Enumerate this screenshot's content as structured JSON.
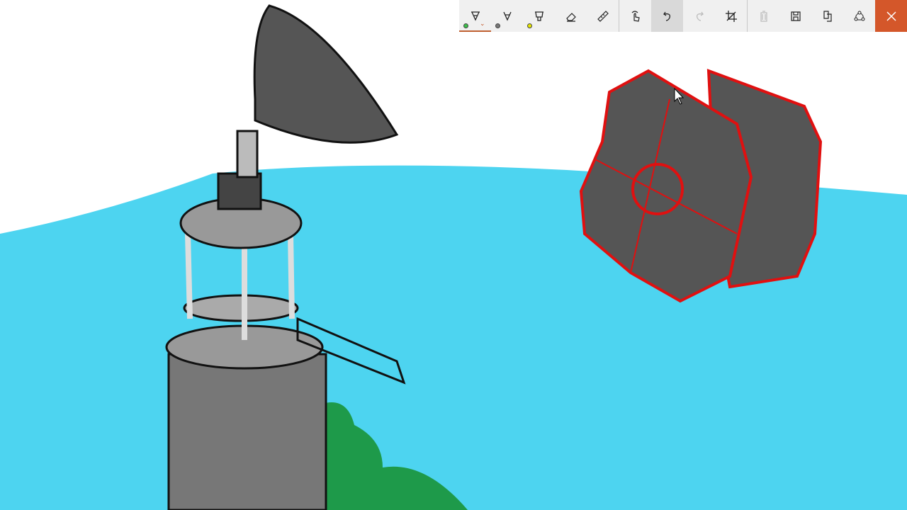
{
  "toolbar": {
    "tools": [
      {
        "name": "ballpoint-pen",
        "color": "#3cc04a",
        "selected": true
      },
      {
        "name": "pencil",
        "color": "#777777"
      },
      {
        "name": "highlighter",
        "color": "#e6e600"
      },
      {
        "name": "eraser"
      },
      {
        "name": "ruler"
      }
    ],
    "actions": [
      "touch-writing",
      "undo",
      "redo",
      "crop",
      "delete",
      "save",
      "copy",
      "share",
      "close"
    ],
    "close_color": "#d4572a"
  },
  "colors": {
    "sky": "#4dd4f0",
    "tower": "#8a8a8a",
    "dish": "#555555",
    "bush": "#1e9a4a",
    "outline_red": "#e01010"
  }
}
